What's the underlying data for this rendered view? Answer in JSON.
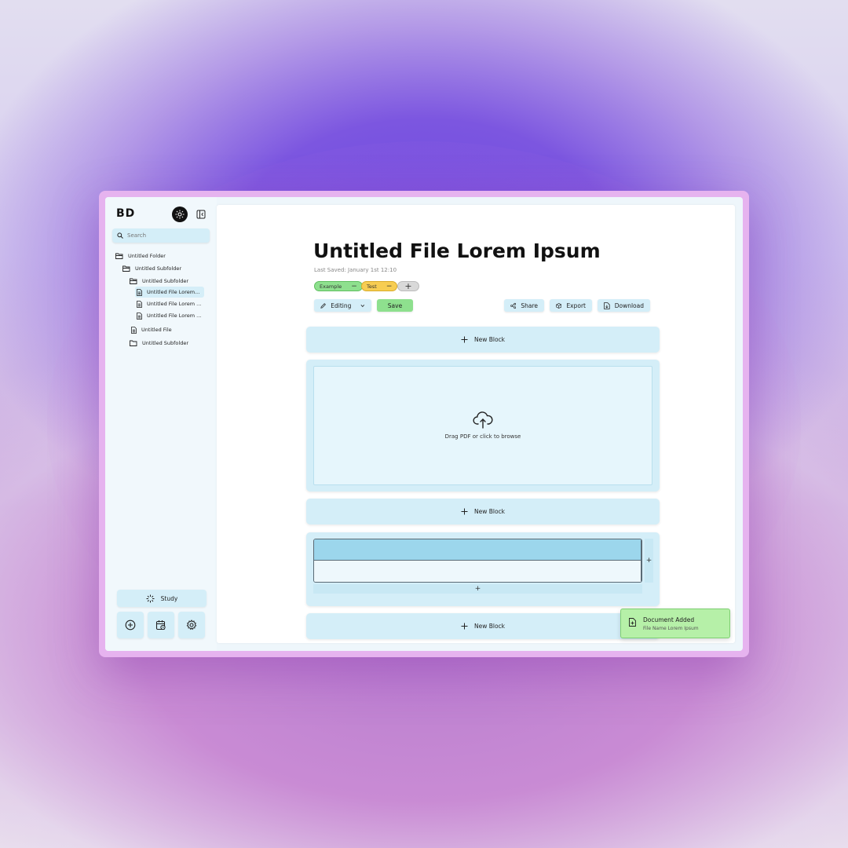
{
  "app": {
    "logo": "BD"
  },
  "sidebar": {
    "search_placeholder": "Search",
    "tree": [
      {
        "label": "Untitled Folder",
        "icon": "folder-open-icon"
      },
      {
        "label": "Untitled Subfolder",
        "icon": "folder-open-icon"
      },
      {
        "label": "Untitled Subfolder",
        "icon": "folder-open-icon"
      },
      {
        "label": "Untitled File Lorem...",
        "icon": "file-icon"
      },
      {
        "label": "Untitled File Lorem ...",
        "icon": "file-icon"
      },
      {
        "label": "Untitled File Lorem ...",
        "icon": "file-icon"
      },
      {
        "label": "Untitled File",
        "icon": "file-icon"
      },
      {
        "label": "Untitled Subfolder",
        "icon": "folder-icon"
      }
    ],
    "study_label": "Study"
  },
  "document": {
    "title": "Untitled File Lorem Ipsum",
    "last_saved": "Last Saved: January 1st 12:10",
    "tags": [
      {
        "label": "Example",
        "color": "#8ee08e"
      },
      {
        "label": "Test",
        "color": "#f7cd52"
      }
    ],
    "toolbar": {
      "mode_label": "Editing",
      "save_label": "Save",
      "share_label": "Share",
      "export_label": "Export",
      "download_label": "Download"
    },
    "new_block_label": "New Block",
    "upload_label": "Drag PDF or click to browse"
  },
  "toast": {
    "title": "Document Added",
    "subtitle": "File Name Lorem Ipsum"
  },
  "colors": {
    "accent": "#d4eef8",
    "save": "#8ee08e",
    "toast": "#b6f0a8",
    "frame": "#e6b3ef"
  }
}
